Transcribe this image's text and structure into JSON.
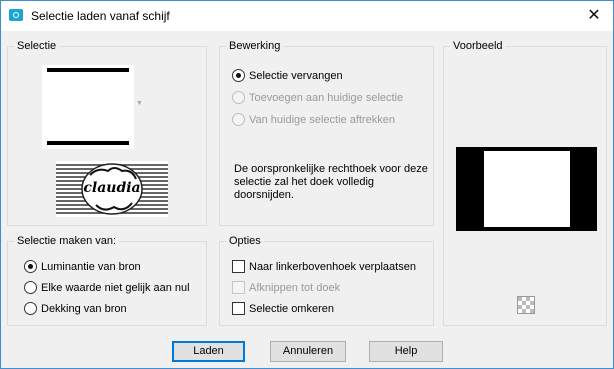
{
  "window": {
    "title": "Selectie laden vanaf schijf",
    "close_glyph": "✕"
  },
  "selectie": {
    "title": "Selectie"
  },
  "bewerking": {
    "title": "Bewerking",
    "options": [
      {
        "label": "Selectie vervangen",
        "selected": true,
        "enabled": true
      },
      {
        "label": "Toevoegen aan huidige selectie",
        "selected": false,
        "enabled": false
      },
      {
        "label": "Van huidige selectie aftrekken",
        "selected": false,
        "enabled": false
      }
    ],
    "description": "De oorspronkelijke rechthoek voor deze selectie zal het doek volledig doorsnijden."
  },
  "voorbeeld": {
    "title": "Voorbeeld"
  },
  "maken_van": {
    "title": "Selectie maken van:",
    "options": [
      {
        "label": "Luminantie van bron",
        "selected": true
      },
      {
        "label": "Elke waarde niet gelijk aan nul",
        "selected": false
      },
      {
        "label": "Dekking van bron",
        "selected": false
      }
    ]
  },
  "opties": {
    "title": "Opties",
    "options": [
      {
        "label": "Naar linkerbovenhoek verplaatsen",
        "checked": false,
        "enabled": true
      },
      {
        "label": "Afknippen tot doek",
        "checked": false,
        "enabled": false
      },
      {
        "label": "Selectie omkeren",
        "checked": false,
        "enabled": true
      }
    ]
  },
  "buttons": {
    "ok": "Laden",
    "cancel": "Annuleren",
    "help": "Help"
  },
  "watermark": {
    "text": "claudia"
  }
}
